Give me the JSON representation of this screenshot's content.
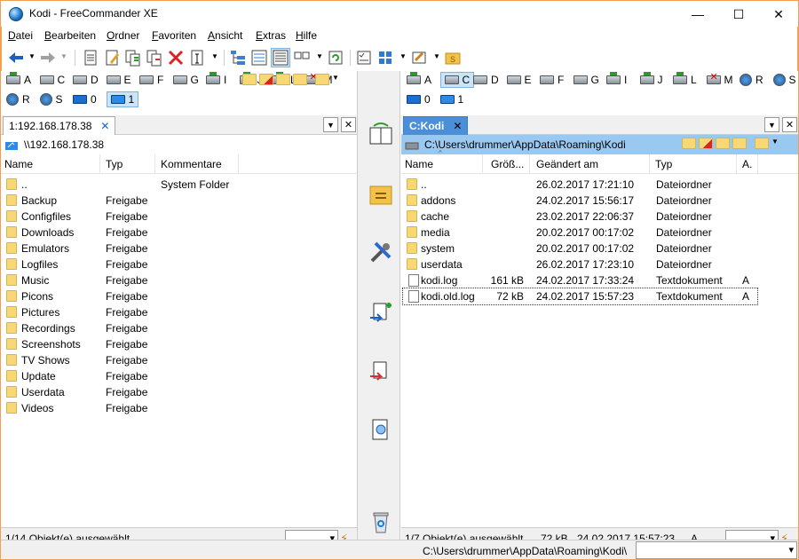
{
  "window": {
    "title": "Kodi - FreeCommander XE",
    "min": "—",
    "max": "☐",
    "close": "✕"
  },
  "menu": [
    "Datei",
    "Bearbeiten",
    "Ordner",
    "Favoriten",
    "Ansicht",
    "Extras",
    "Hilfe"
  ],
  "left": {
    "drives_row1": [
      {
        "l": "A",
        "t": "net"
      },
      {
        "l": "C",
        "t": ""
      },
      {
        "l": "D",
        "t": ""
      },
      {
        "l": "E",
        "t": ""
      },
      {
        "l": "F",
        "t": ""
      },
      {
        "l": "G",
        "t": ""
      },
      {
        "l": "I",
        "t": "net"
      },
      {
        "l": "J",
        "t": "net"
      },
      {
        "l": "L",
        "t": "net"
      },
      {
        "l": "M",
        "t": "x"
      }
    ],
    "drives_row2": [
      {
        "l": "R",
        "t": "globe"
      },
      {
        "l": "S",
        "t": "globe"
      },
      {
        "l": "0",
        "t": "mon"
      },
      {
        "l": "1",
        "t": "share",
        "sel": true
      }
    ],
    "tab": "1:192.168.178.38",
    "path": "\\\\192.168.178.38",
    "columns": [
      "Name",
      "Typ",
      "Kommentare"
    ],
    "rows": [
      {
        "name": "..",
        "typ": "",
        "komm": "System Folder"
      },
      {
        "name": "Backup",
        "typ": "Freigabe",
        "komm": ""
      },
      {
        "name": "Configfiles",
        "typ": "Freigabe",
        "komm": ""
      },
      {
        "name": "Downloads",
        "typ": "Freigabe",
        "komm": ""
      },
      {
        "name": "Emulators",
        "typ": "Freigabe",
        "komm": ""
      },
      {
        "name": "Logfiles",
        "typ": "Freigabe",
        "komm": ""
      },
      {
        "name": "Music",
        "typ": "Freigabe",
        "komm": ""
      },
      {
        "name": "Picons",
        "typ": "Freigabe",
        "komm": ""
      },
      {
        "name": "Pictures",
        "typ": "Freigabe",
        "komm": ""
      },
      {
        "name": "Recordings",
        "typ": "Freigabe",
        "komm": ""
      },
      {
        "name": "Screenshots",
        "typ": "Freigabe",
        "komm": ""
      },
      {
        "name": "TV Shows",
        "typ": "Freigabe",
        "komm": ""
      },
      {
        "name": "Update",
        "typ": "Freigabe",
        "komm": ""
      },
      {
        "name": "Userdata",
        "typ": "Freigabe",
        "komm": ""
      },
      {
        "name": "Videos",
        "typ": "Freigabe",
        "komm": ""
      }
    ],
    "status": "1/14 Objekt(e) ausgewählt"
  },
  "right": {
    "drives_row1": [
      {
        "l": "A",
        "t": "net"
      },
      {
        "l": "C",
        "t": "",
        "sel": true
      },
      {
        "l": "D",
        "t": ""
      },
      {
        "l": "E",
        "t": ""
      },
      {
        "l": "F",
        "t": ""
      },
      {
        "l": "G",
        "t": ""
      },
      {
        "l": "I",
        "t": "net"
      },
      {
        "l": "J",
        "t": "net"
      },
      {
        "l": "L",
        "t": "net"
      },
      {
        "l": "M",
        "t": "x"
      },
      {
        "l": "R",
        "t": "globe"
      },
      {
        "l": "S",
        "t": "globe"
      }
    ],
    "drives_row2": [
      {
        "l": "0",
        "t": "mon"
      },
      {
        "l": "1",
        "t": "share"
      }
    ],
    "tab": "C:Kodi",
    "path": "C:\\Users\\drummer\\AppData\\Roaming\\Kodi",
    "columns": [
      "Name",
      "Größ...",
      "Geändert am",
      "Typ",
      "A."
    ],
    "rows": [
      {
        "name": "..",
        "size": "",
        "date": "26.02.2017  17:21:10",
        "typ": "Dateiordner",
        "attr": "",
        "kind": "folder"
      },
      {
        "name": "addons",
        "size": "",
        "date": "24.02.2017  15:56:17",
        "typ": "Dateiordner",
        "attr": "",
        "kind": "folder"
      },
      {
        "name": "cache",
        "size": "",
        "date": "23.02.2017  22:06:37",
        "typ": "Dateiordner",
        "attr": "",
        "kind": "folder"
      },
      {
        "name": "media",
        "size": "",
        "date": "20.02.2017  00:17:02",
        "typ": "Dateiordner",
        "attr": "",
        "kind": "folder"
      },
      {
        "name": "system",
        "size": "",
        "date": "20.02.2017  00:17:02",
        "typ": "Dateiordner",
        "attr": "",
        "kind": "folder"
      },
      {
        "name": "userdata",
        "size": "",
        "date": "26.02.2017  17:23:10",
        "typ": "Dateiordner",
        "attr": "",
        "kind": "folder"
      },
      {
        "name": "kodi.log",
        "size": "161 kB",
        "date": "24.02.2017  17:33:24",
        "typ": "Textdokument",
        "attr": "A",
        "kind": "file"
      },
      {
        "name": "kodi.old.log",
        "size": "72 kB",
        "date": "24.02.2017  15:57:23",
        "typ": "Textdokument",
        "attr": "A",
        "kind": "file",
        "focus": true
      }
    ],
    "status": "1/7 Objekt(e) ausgewählt",
    "status_size": "72 kB",
    "status_date": "24.02.2017 15:57:23",
    "status_attr": "A"
  },
  "bottom_path": "C:\\Users\\drummer\\AppData\\Roaming\\Kodi\\"
}
